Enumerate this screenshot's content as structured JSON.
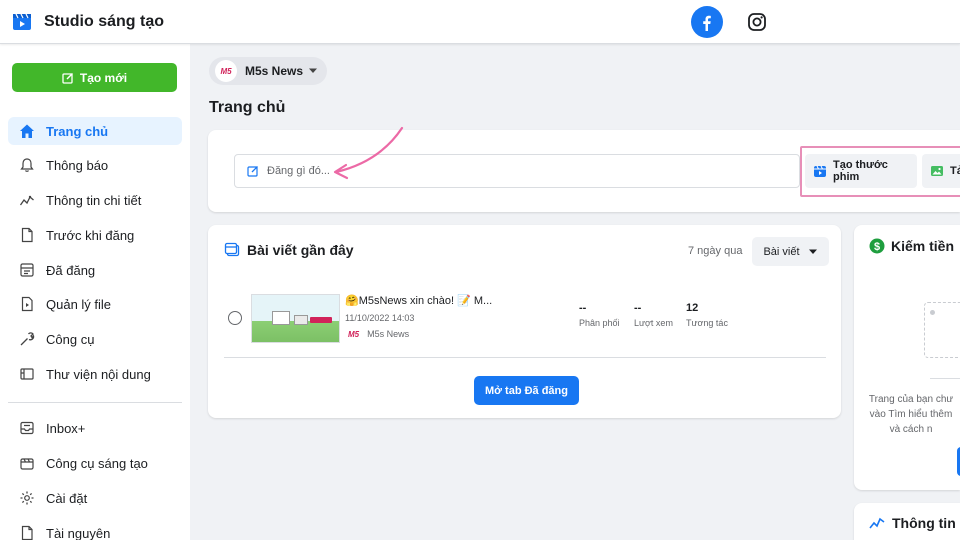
{
  "app": {
    "title": "Studio sáng tạo"
  },
  "topbar": {
    "facebook_icon": "facebook-icon",
    "instagram_icon": "instagram-icon"
  },
  "sidebar": {
    "create_label": "Tạo mới",
    "items": [
      {
        "label": "Trang chủ",
        "icon": "home-icon",
        "active": true
      },
      {
        "label": "Thông báo",
        "icon": "bell-icon"
      },
      {
        "label": "Thông tin chi tiết",
        "icon": "insights-icon"
      },
      {
        "label": "Trước khi đăng",
        "icon": "document-icon"
      },
      {
        "label": "Đã đăng",
        "icon": "published-icon"
      },
      {
        "label": "Quản lý file",
        "icon": "file-video-icon"
      },
      {
        "label": "Công cụ",
        "icon": "wrench-icon"
      },
      {
        "label": "Thư viện nội dung",
        "icon": "content-library-icon"
      },
      {
        "label": "Inbox+",
        "icon": "inbox-icon"
      },
      {
        "label": "Công cụ sáng tạo",
        "icon": "creative-tools-icon"
      },
      {
        "label": "Cài đặt",
        "icon": "gear-icon"
      },
      {
        "label": "Tài nguyên",
        "icon": "resources-icon"
      }
    ]
  },
  "page_selector": {
    "name": "M5s News",
    "logo_text": "M5"
  },
  "main": {
    "title": "Trang chủ",
    "compose": {
      "placeholder": "Đăng gì đó...",
      "reel_label": "Tạo thước phim",
      "photo_label": "Tải"
    },
    "recent": {
      "title": "Bài viết gần đây",
      "range": "7 ngày qua",
      "filter": "Bài viết",
      "posts": [
        {
          "title": "🤗M5sNews xin chào! 📝 M...",
          "date": "11/10/2022 14:03",
          "page": "M5s News",
          "page_logo": "M5",
          "distribution": {
            "value": "--",
            "label": "Phân phối"
          },
          "views": {
            "value": "--",
            "label": "Lượt xem"
          },
          "engagement": {
            "value": "12",
            "label": "Tương tác"
          }
        }
      ],
      "open_tab_label": "Mở tab Đã đăng"
    },
    "monetize": {
      "title": "Kiếm tiền",
      "text_lines": [
        "Trang của bạn chư",
        "vào Tìm hiểu thêm",
        "và cách n"
      ]
    },
    "insights": {
      "title": "Thông tin c"
    }
  },
  "colors": {
    "primary": "#1877f2",
    "create_green": "#42b72a",
    "highlight_pink": "#e78fb8",
    "active_bg": "#e7f3ff"
  }
}
